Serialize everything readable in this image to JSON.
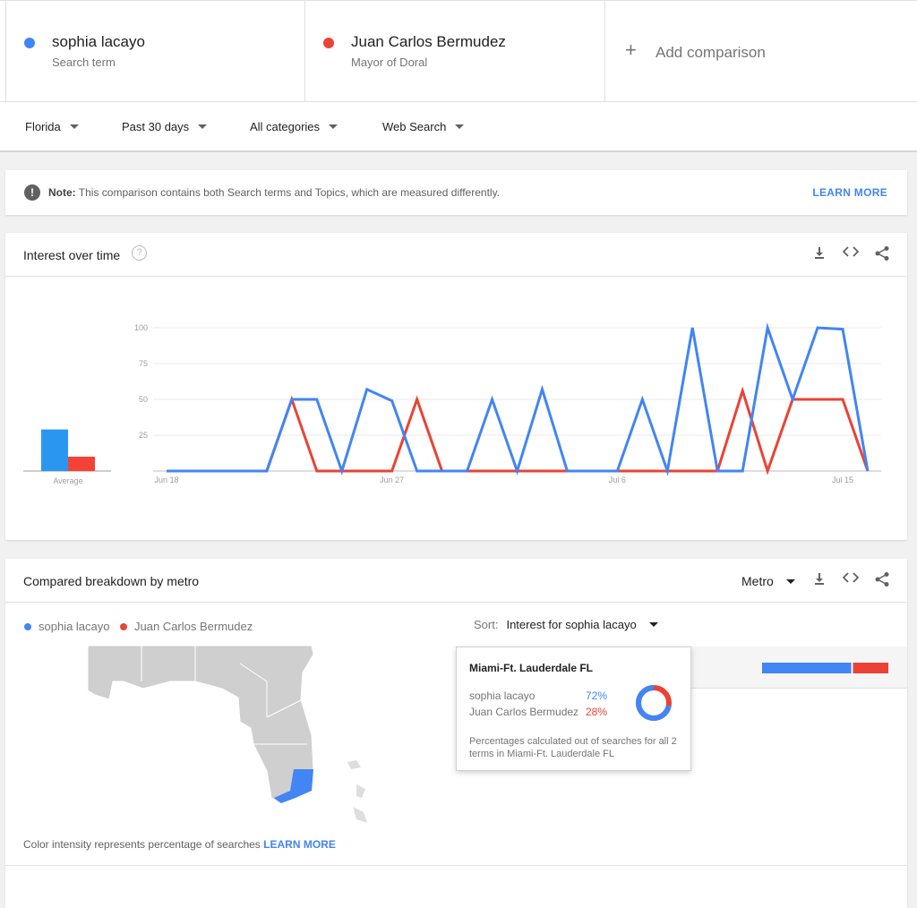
{
  "colors": {
    "blue": "#4285f4",
    "red": "#ea4335",
    "blue_bar": "#2b96f0",
    "red_bar": "#f44336"
  },
  "terms": [
    {
      "name": "sophia lacayo",
      "subtitle": "Search term",
      "color": "#4285f4"
    },
    {
      "name": "Juan Carlos Bermudez",
      "subtitle": "Mayor of Doral",
      "color": "#ea4335"
    }
  ],
  "add_comparison": {
    "icon": "plus-icon",
    "label": "Add comparison"
  },
  "filters": [
    "Florida",
    "Past 30 days",
    "All categories",
    "Web Search"
  ],
  "note": {
    "icon": "exclamation-icon",
    "bold": "Note:",
    "text": " This comparison contains both Search terms and Topics, which are measured differently.",
    "link": "LEARN MORE"
  },
  "interest_over_time": {
    "title": "Interest over time",
    "help_icon": "question-icon",
    "tools": [
      "download-icon",
      "embed-icon",
      "share-icon"
    ],
    "average_label": "Average"
  },
  "chart_data": {
    "type": "line",
    "x": [
      "Jun 18",
      "Jun 19",
      "Jun 20",
      "Jun 21",
      "Jun 22",
      "Jun 23",
      "Jun 24",
      "Jun 25",
      "Jun 26",
      "Jun 27",
      "Jun 28",
      "Jun 29",
      "Jun 30",
      "Jul 1",
      "Jul 2",
      "Jul 3",
      "Jul 4",
      "Jul 5",
      "Jul 6",
      "Jul 7",
      "Jul 8",
      "Jul 9",
      "Jul 10",
      "Jul 11",
      "Jul 12",
      "Jul 13",
      "Jul 14",
      "Jul 15"
    ],
    "x_tick_labels": [
      "Jun 18",
      "Jun 27",
      "Jul 6",
      "Jul 15"
    ],
    "y_ticks": [
      25,
      50,
      75,
      100
    ],
    "ylim": [
      0,
      100
    ],
    "grid": true,
    "series": [
      {
        "name": "sophia lacayo",
        "color": "#4285f4",
        "values": [
          0,
          0,
          0,
          0,
          0,
          50,
          50,
          0,
          57,
          49,
          0,
          0,
          0,
          50,
          0,
          57,
          0,
          0,
          0,
          50,
          0,
          100,
          0,
          0,
          100,
          50,
          100,
          99,
          0
        ]
      },
      {
        "name": "Juan Carlos Bermudez",
        "color": "#ea4335",
        "values": [
          0,
          0,
          0,
          0,
          0,
          50,
          0,
          0,
          0,
          0,
          50,
          0,
          0,
          0,
          0,
          0,
          0,
          0,
          0,
          0,
          0,
          0,
          0,
          56,
          0,
          50,
          50,
          50,
          0
        ]
      }
    ],
    "averages": [
      {
        "name": "sophia lacayo",
        "value": 29
      },
      {
        "name": "Juan Carlos Bermudez",
        "value": 10
      }
    ]
  },
  "metro": {
    "title": "Compared breakdown by metro",
    "dropdown": "Metro",
    "tools": [
      "download-icon",
      "embed-icon",
      "share-icon"
    ],
    "legend": [
      "sophia lacayo",
      "Juan Carlos Bermudez"
    ],
    "sort_label": "Sort:",
    "sort_value": "Interest for sophia lacayo",
    "row_bar": {
      "blue_pct": 72,
      "red_pct": 28
    },
    "tooltip": {
      "title": "Miami-Ft. Lauderdale FL",
      "rows": [
        {
          "name": "sophia lacayo",
          "pct": "72%",
          "value": 72
        },
        {
          "name": "Juan Carlos Bermudez",
          "pct": "28%",
          "value": 28
        }
      ],
      "footer": "Percentages calculated out of searches for all 2 terms in Miami-Ft. Lauderdale FL"
    },
    "map_note": "Color intensity represents percentage of searches ",
    "map_link": "LEARN MORE"
  }
}
